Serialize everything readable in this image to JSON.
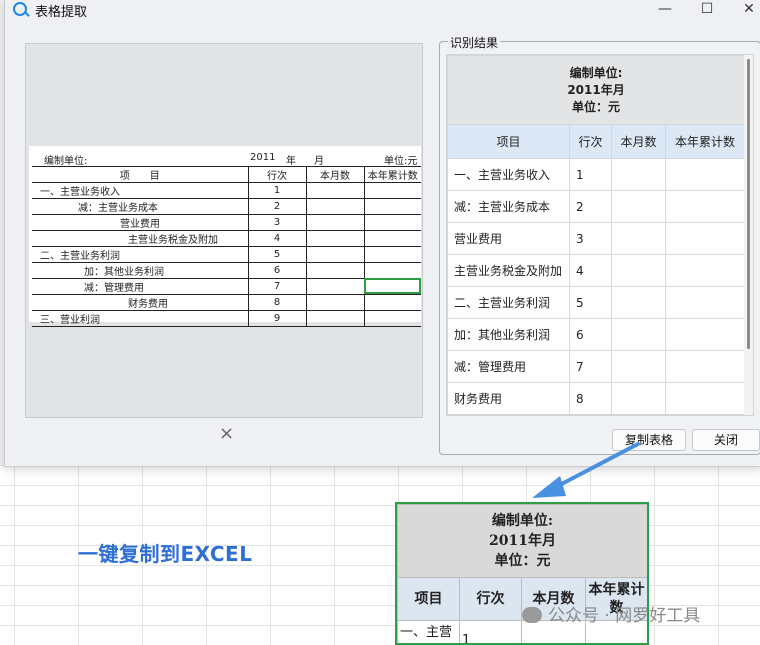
{
  "window": {
    "title": "表格提取",
    "minimize": "—",
    "maximize": "☐",
    "close": "✕"
  },
  "preview": {
    "header": {
      "unit": "编制单位:",
      "year": "2011",
      "year_unit": "年",
      "month_unit": "月",
      "money": "单位:元"
    },
    "columns": [
      "项　　目",
      "行次",
      "本月数",
      "本年累计数"
    ],
    "rows": [
      {
        "item": "一、主营业务收入",
        "no": "1"
      },
      {
        "item": "减：主营业务成本",
        "no": "2"
      },
      {
        "item": "营业费用",
        "no": "3"
      },
      {
        "item": "主营业务税金及附加",
        "no": "4"
      },
      {
        "item": "二、主营业务利润",
        "no": "5"
      },
      {
        "item": "加：其他业务利润",
        "no": "6"
      },
      {
        "item": "减：管理费用",
        "no": "7"
      },
      {
        "item": "财务费用",
        "no": "8"
      },
      {
        "item": "三、营业利润",
        "no": "9"
      }
    ],
    "close_label": "×"
  },
  "result": {
    "legend": "识别结果",
    "header_lines": [
      "编制单位:",
      "2011年月",
      "单位：元"
    ],
    "columns": [
      "项目",
      "行次",
      "本月数",
      "本年累计数"
    ],
    "rows": [
      {
        "item": "一、主营业务收入",
        "no": "1"
      },
      {
        "item": "减：主营业务成本",
        "no": "2"
      },
      {
        "item": "营业费用",
        "no": "3"
      },
      {
        "item": "主营业务税金及附加",
        "no": "4"
      },
      {
        "item": "二、主营业务利润",
        "no": "5"
      },
      {
        "item": "加：其他业务利润",
        "no": "6"
      },
      {
        "item": "减：管理费用",
        "no": "7"
      },
      {
        "item": "财务费用",
        "no": "8"
      }
    ],
    "copy_button": "复制表格",
    "close_button": "关闭"
  },
  "callout": "一键复制到EXCEL",
  "excel": {
    "header_lines": [
      "编制单位:",
      "2011年月",
      "单位：元"
    ],
    "columns": [
      "项目",
      "行次",
      "本月数",
      "本年累计数"
    ],
    "first_row": {
      "item": "一、主营业务收入",
      "no": "1"
    }
  },
  "watermark": "公众号 · 网罗好工具",
  "colors": {
    "accent_blue": "#2e6fd6",
    "selection_green": "#2e9d43",
    "arrow_blue": "#4a90e2"
  }
}
